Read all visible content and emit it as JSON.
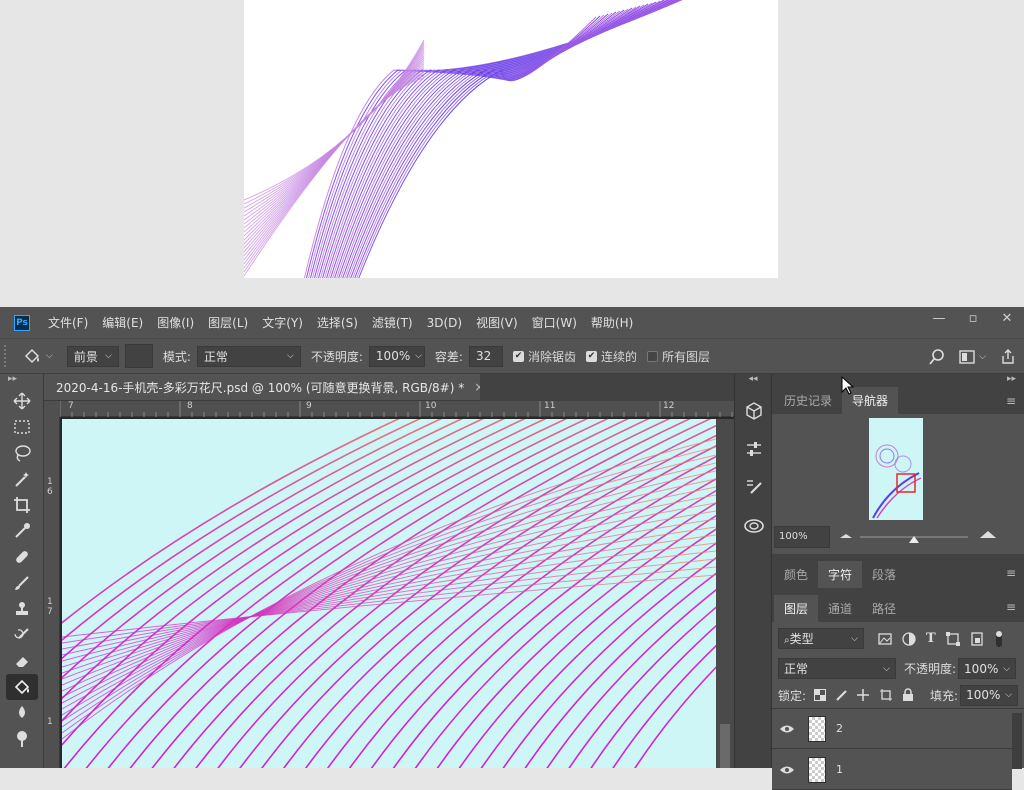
{
  "menubar": {
    "logo": "Ps",
    "items": [
      "文件(F)",
      "编辑(E)",
      "图像(I)",
      "图层(L)",
      "文字(Y)",
      "选择(S)",
      "滤镜(T)",
      "3D(D)",
      "视图(V)",
      "窗口(W)",
      "帮助(H)"
    ],
    "window_controls": [
      "—",
      "▫",
      "✕"
    ]
  },
  "options": {
    "fill_source": "前景",
    "mode_label": "模式:",
    "mode_value": "正常",
    "opacity_label": "不透明度:",
    "opacity_value": "100%",
    "tolerance_label": "容差:",
    "tolerance_value": "32",
    "anti_alias_label": "消除锯齿",
    "contiguous_label": "连续的",
    "all_layers_label": "所有图层"
  },
  "toolbar": {
    "collapse": "▸▸",
    "tools": [
      "move-tool",
      "marquee-tool",
      "lasso-tool",
      "quick-select-tool",
      "crop-tool",
      "eyedropper-tool",
      "healing-brush-tool",
      "brush-tool",
      "clone-stamp-tool",
      "history-brush-tool",
      "eraser-tool",
      "paint-bucket-tool",
      "blur-tool",
      "dodge-tool"
    ]
  },
  "document": {
    "tab_title": "2020-4-16-手机壳-多彩万花尺.psd @ 100% (可随意更换背景, RGB/8#) *",
    "close": "×",
    "ruler_top": [
      "7",
      "8",
      "9",
      "10",
      "11",
      "12"
    ],
    "ruler_left": [
      "1\n6",
      "1\n7",
      "1"
    ]
  },
  "panels": {
    "top_collapse": "◂◂",
    "top_expand": "▸▸",
    "history_tab": "历史记录",
    "navigator_tab": "导航器",
    "nav_zoom": "100%",
    "color_tab": "颜色",
    "character_tab": "字符",
    "paragraph_tab": "段落",
    "layers_tab": "图层",
    "channels_tab": "通道",
    "paths_tab": "路径",
    "filter_kind": "类型",
    "blend_mode": "正常",
    "opacity_label": "不透明度:",
    "opacity_value": "100%",
    "lock_label": "锁定:",
    "fill_label": "填充:",
    "fill_value": "100%",
    "layers": [
      {
        "name": "2"
      },
      {
        "name": "1"
      }
    ],
    "menu_icon": "≡"
  },
  "colors": {
    "canvas_bg": "#cff6f6",
    "stroke_start": "#d21fd6",
    "stroke_end": "#e7836b",
    "preview_stroke_a": "#5a3cf0",
    "preview_stroke_b": "#d45ad8"
  }
}
